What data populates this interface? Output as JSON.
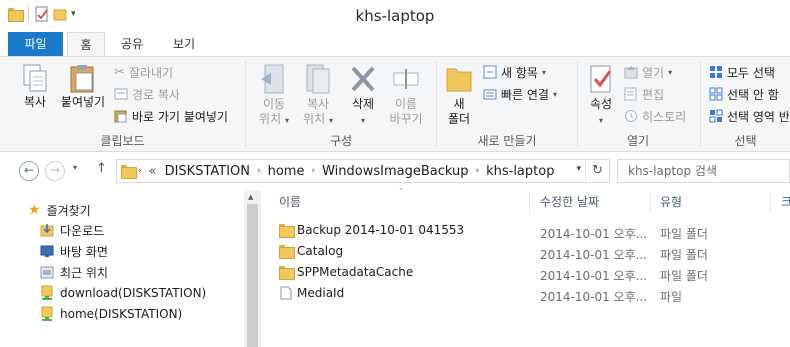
{
  "window": {
    "title": "khs-laptop"
  },
  "ribbon_tabs": [
    "파일",
    "홈",
    "공유",
    "보기"
  ],
  "ribbon": {
    "clipboard": {
      "label": "클립보드",
      "copy": "복사",
      "paste": "붙여넣기",
      "cut": "잘라내기",
      "copy_path": "경로 복사",
      "paste_shortcut": "바로 가기 붙여넣기"
    },
    "organize": {
      "label": "구성",
      "move_to": [
        "이동",
        "위치"
      ],
      "copy_to": [
        "복사",
        "위치"
      ],
      "delete": "삭제",
      "rename": [
        "이름",
        "바꾸기"
      ]
    },
    "new": {
      "label": "새로 만들기",
      "new_folder": [
        "새",
        "폴더"
      ],
      "new_item": "새 항목",
      "easy_access": "빠른 연결"
    },
    "open": {
      "label": "열기",
      "properties": "속성",
      "open": "열기",
      "edit": "편집",
      "history": "히스토리"
    },
    "select": {
      "label": "선택",
      "select_all": "모두 선택",
      "select_none": "선택 안 함",
      "invert": "선택 영역 반"
    }
  },
  "address": {
    "overflow": "«",
    "segments": [
      "DISKSTATION",
      "home",
      "WindowsImageBackup",
      "khs-laptop"
    ],
    "search_placeholder": "khs-laptop 검색"
  },
  "nav_pane": {
    "favorites": "즐겨찾기",
    "items": [
      "다운로드",
      "바탕 화면",
      "최근 위치",
      "download(DISKSTATION)",
      "home(DISKSTATION)"
    ]
  },
  "columns": [
    "이름",
    "수정한 날짜",
    "유형",
    "크"
  ],
  "files": [
    {
      "name": "Backup 2014-10-01 041553",
      "date": "2014-10-01 오후...",
      "type": "파일 폴더",
      "kind": "folder"
    },
    {
      "name": "Catalog",
      "date": "2014-10-01 오후...",
      "type": "파일 폴더",
      "kind": "folder"
    },
    {
      "name": "SPPMetadataCache",
      "date": "2014-10-01 오후...",
      "type": "파일 폴더",
      "kind": "folder"
    },
    {
      "name": "MediaId",
      "date": "2014-10-01 오후...",
      "type": "파일",
      "kind": "file"
    }
  ]
}
